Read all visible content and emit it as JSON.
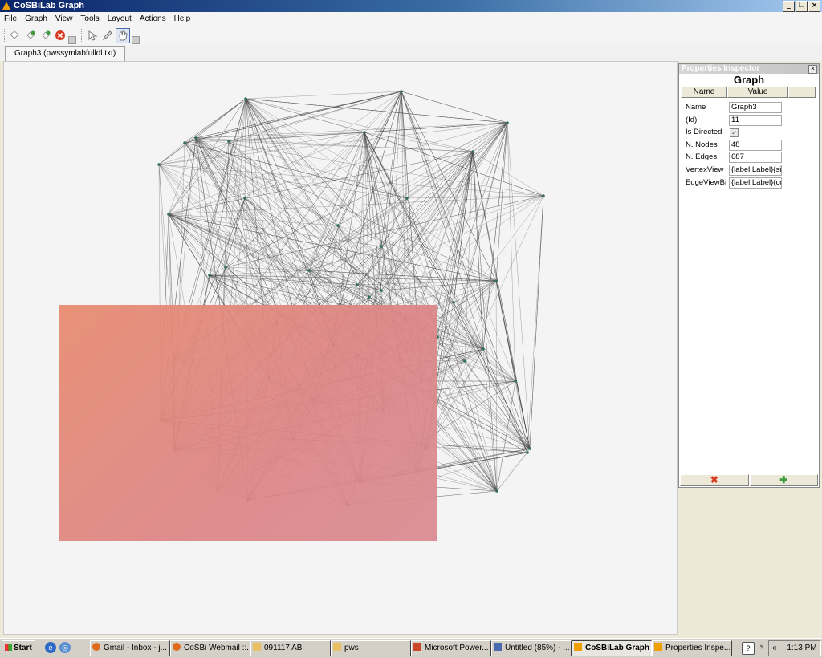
{
  "window": {
    "title": "CoSBiLab Graph",
    "buttons": {
      "minimize": "_",
      "restore": "❐",
      "close": "×"
    }
  },
  "menu": [
    "File",
    "Graph",
    "View",
    "Tools",
    "Layout",
    "Actions",
    "Help"
  ],
  "toolbar": {
    "icons": [
      "new-icon",
      "open-icon",
      "save-icon",
      "stop-icon",
      "pointer-icon",
      "pencil-icon",
      "hand-icon"
    ],
    "colors": {
      "stop": "#d83a24",
      "green": "#3f9b3f"
    }
  },
  "tabs": [
    {
      "label": "Graph3 (pwssymlabfulldl.txt)"
    }
  ],
  "graph": {
    "node_color": "#2f6d63",
    "edge_color": "#4a4a4a",
    "overlay_color": "#e08878"
  },
  "inspector": {
    "title": "Properties Inspector",
    "heading": "Graph",
    "columns": [
      "Name",
      "Value"
    ],
    "rows": [
      {
        "name": "Name",
        "value": "Graph3"
      },
      {
        "name": "(Id)",
        "value": "11"
      },
      {
        "name": "Is Directed",
        "value": ""
      },
      {
        "name": "N. Nodes",
        "value": "48"
      },
      {
        "name": "N. Edges",
        "value": "687"
      },
      {
        "name": "VertexView",
        "value": "{label,Label}{si"
      },
      {
        "name": "EdgeViewBi",
        "value": "{label,Label}{co"
      }
    ],
    "is_directed_checked": true,
    "footer": {
      "remove": "✖",
      "add": "✚"
    }
  },
  "taskbar": {
    "start": "Start",
    "items": [
      {
        "label": "Gmail - Inbox - j...",
        "color": "#e06a1b"
      },
      {
        "label": "CoSBi Webmail ::...",
        "color": "#e06a1b"
      },
      {
        "label": "091117 AB",
        "color": "#e8c060"
      },
      {
        "label": "pws",
        "color": "#e8c060"
      },
      {
        "label": "Microsoft Power...",
        "color": "#c9482b"
      },
      {
        "label": "Untitled (85%) - ...",
        "color": "#4a6ab0"
      },
      {
        "label": "CoSBiLab Graph",
        "color": "#f0a000",
        "active": true
      },
      {
        "label": "Properties Inspe...",
        "color": "#f0a000"
      }
    ],
    "tray": {
      "chevron": "«",
      "clock": "1:13 PM"
    }
  }
}
